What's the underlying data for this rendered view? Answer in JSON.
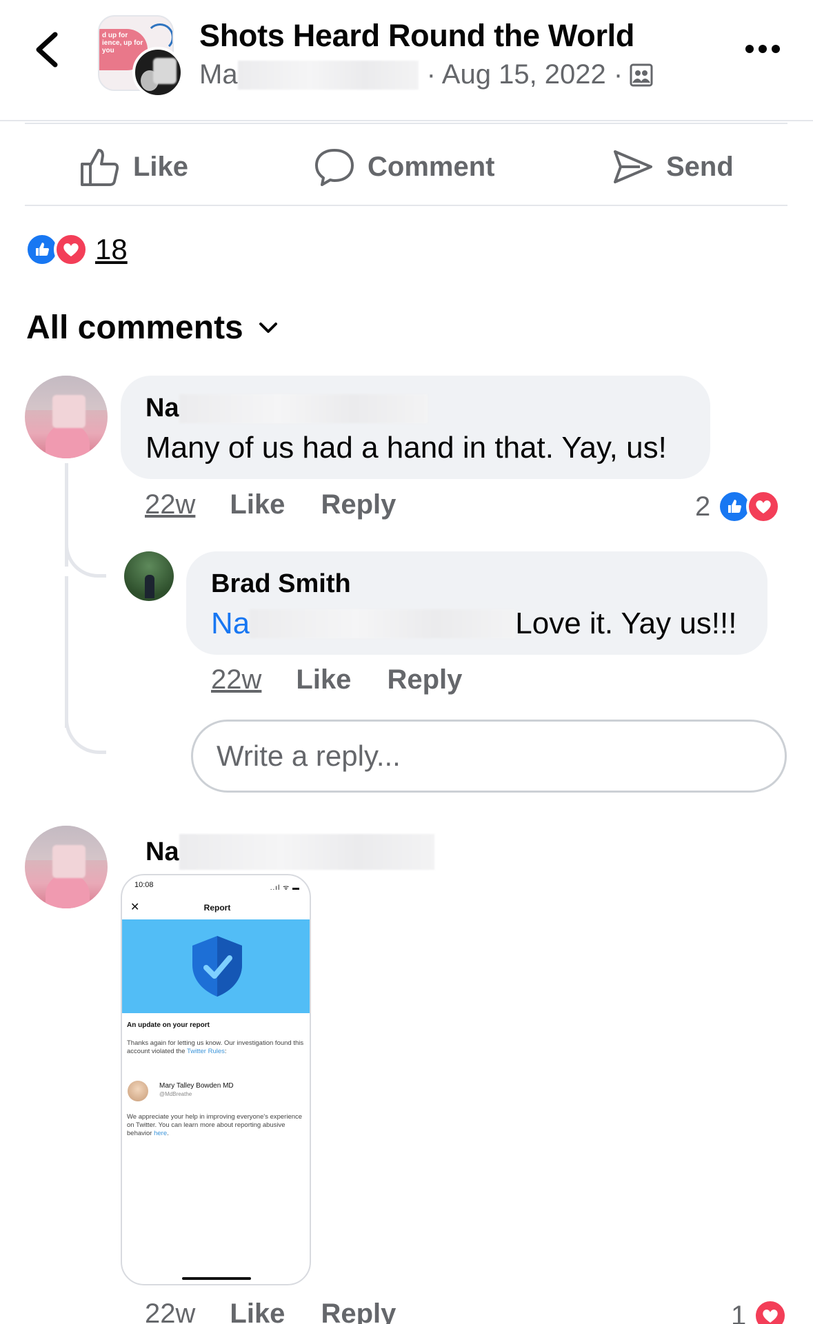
{
  "header": {
    "back_label": "Back",
    "group_avatar_text": "d up for ience, up for you",
    "title": "Shots Heard Round the World",
    "author_prefix": "Ma",
    "date": "· Aug 15, 2022 ·",
    "audience_icon": "group-audience-icon",
    "more_icon": "more-options-icon"
  },
  "actions": {
    "like": "Like",
    "comment": "Comment",
    "send": "Send"
  },
  "reactions": {
    "count": "18",
    "types": [
      "like",
      "love"
    ],
    "colors": {
      "like": "#1877f2",
      "love": "#f33e58"
    }
  },
  "comments_filter": {
    "label": "All comments"
  },
  "comments": [
    {
      "author_prefix": "Na",
      "text": "Many of us had a hand in that. Yay, us!",
      "time": "22w",
      "like": "Like",
      "reply": "Reply",
      "reaction_count": "2"
    },
    {
      "author_prefix": "Na",
      "time": "22w",
      "like": "Like",
      "reply": "Reply",
      "reaction_count": "1"
    }
  ],
  "reply": {
    "author": "Brad Smith",
    "mention_prefix": "Na",
    "text": "Love it. Yay us!!!",
    "time": "22w",
    "like": "Like",
    "reply": "Reply"
  },
  "reply_input": {
    "placeholder": "Write a reply..."
  },
  "attachment": {
    "status_time": "10:08",
    "status_icons": "..ıl ᯤ ▬",
    "close": "✕",
    "title": "Report",
    "heading": "An update on your report",
    "body1_a": "Thanks again for letting us know. Our investigation found this account violated the ",
    "body1_link": "Twitter Rules",
    "body1_b": ":",
    "reported_name": "Mary Talley Bowden MD",
    "reported_handle": "@MdBreathe",
    "body2_a": "We appreciate your help in improving everyone's experience on Twitter. You can learn more about reporting abusive behavior ",
    "body2_link": "here",
    "body2_b": "."
  },
  "colors": {
    "accent": "#1877f2",
    "muted_text": "#65676b",
    "bubble": "#f0f2f5"
  }
}
